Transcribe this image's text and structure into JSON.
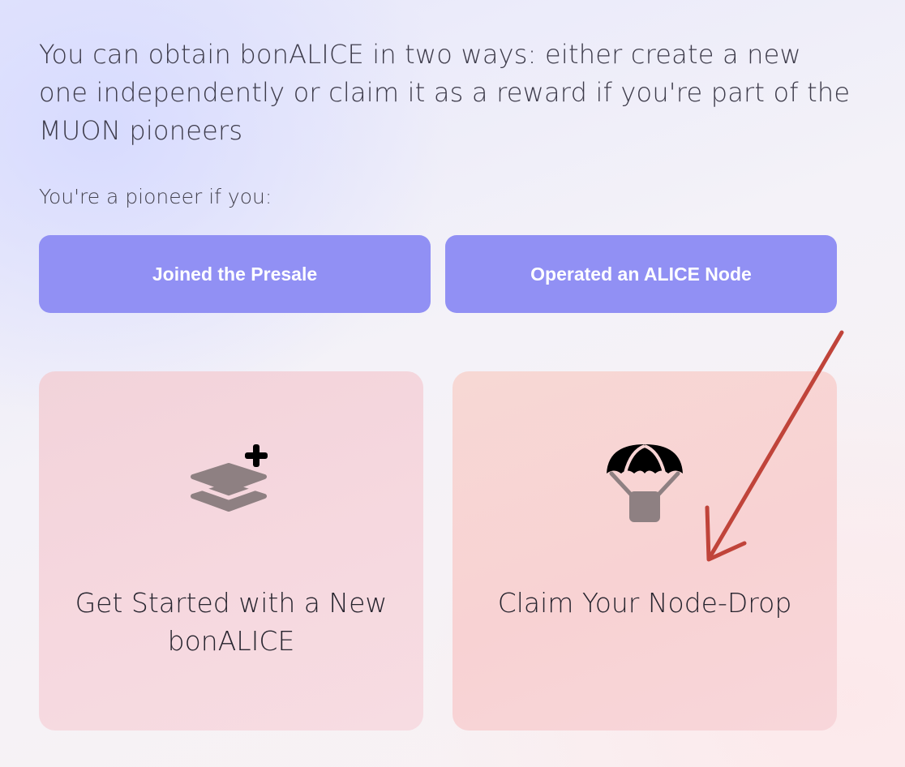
{
  "intro_text": "You can obtain bonALICE in two ways: either create a new one independently or claim it as a reward if you're part of the MUON pioneers",
  "pioneer_label": "You're a pioneer if you:",
  "criteria": {
    "presale_label": "Joined the Presale",
    "node_label": "Operated an ALICE Node"
  },
  "cards": {
    "new": {
      "title": "Get Started with a New bonALICE",
      "icon": "layers-plus-icon"
    },
    "claim": {
      "title": "Claim Your Node-Drop",
      "icon": "airdrop-parachute-icon"
    }
  },
  "colors": {
    "button_bg": "#9190f4",
    "card_new_bg": "#f5d6dd",
    "card_claim_bg": "#f8d4d4",
    "annotation_arrow": "#c0443a",
    "icon_gray": "#8e8082"
  }
}
